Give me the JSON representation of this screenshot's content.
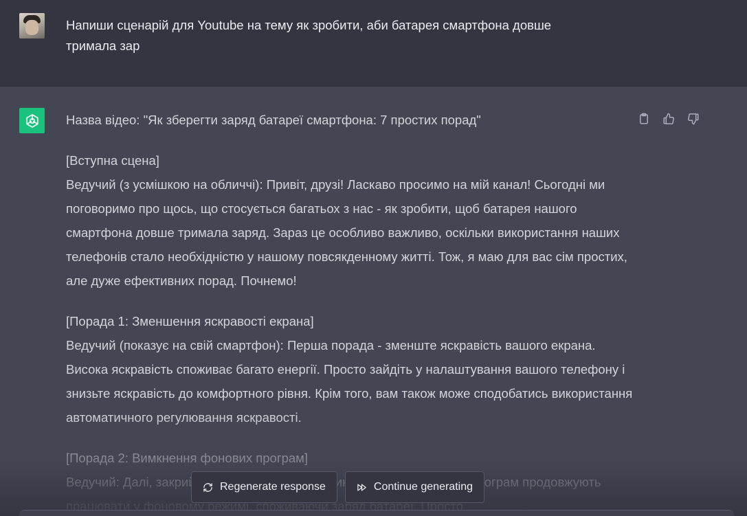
{
  "user_message": {
    "text": "Напиши сценарій для Youtube на тему як зробити, аби батарея смартфона довше тримала зар"
  },
  "assistant_message": {
    "paragraphs": [
      [
        "Назва відео: \"Як зберегти заряд батареї смартфона: 7 простих порад\""
      ],
      [
        "[Вступна сцена]",
        "Ведучий (з усмішкою на обличчі): Привіт, друзі! Ласкаво просимо на мій канал! Сьогодні ми поговоримо про щось, що стосується багатьох з нас - як зробити, щоб батарея нашого смартфона довше тримала заряд. Зараз це особливо важливо, оскільки використання наших телефонів стало необхідністю у нашому повсякденному житті. Тож, я маю для вас сім простих, але дуже ефективних порад. Почнемо!"
      ],
      [
        "[Порада 1: Зменшення яскравості екрана]",
        "Ведучий (показує на свій смартфон): Перша порада - зменште яскравість вашого екрана. Висока яскравість споживає багато енергії. Просто зайдіть у налаштування вашого телефону і знизьте яскравість до комфортного рівня. Крім того, вам також може сподобатись використання автоматичного регулювання яскравості."
      ],
      [
        "[Порада 2: Вимкнення фонових програм]",
        "Ведучий: Далі, закрийте програми, які ви не використовуєте. Багато програм продовжують працювати у фоновому режимі, споживаючи заряд батареї. Просто"
      ]
    ]
  },
  "actions": {
    "copy": "clipboard-icon",
    "like": "thumbs-up-icon",
    "dislike": "thumbs-down-icon"
  },
  "buttons": {
    "regenerate": "Regenerate response",
    "continue": "Continue generating"
  },
  "colors": {
    "user_bg": "#343541",
    "assistant_bg": "#444654",
    "brand": "#19c37d"
  }
}
